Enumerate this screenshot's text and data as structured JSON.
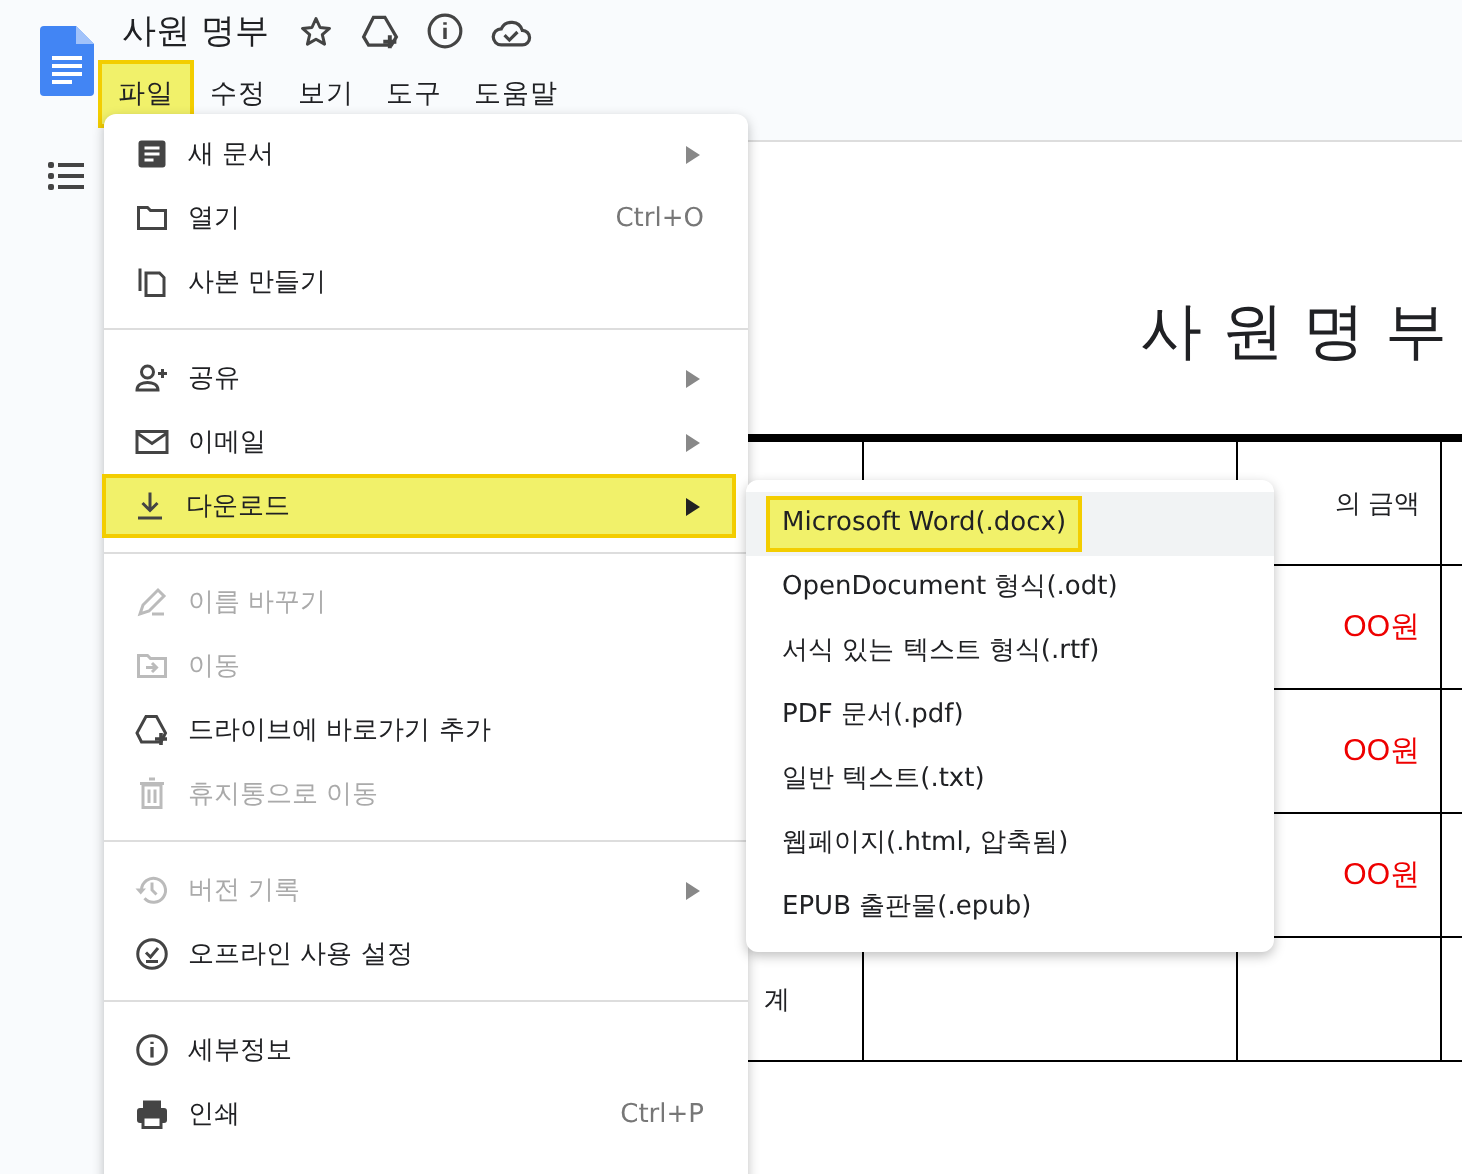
{
  "document": {
    "title": "사원 명부"
  },
  "menubar": [
    {
      "label": "파일",
      "selected": true
    },
    {
      "label": "수정",
      "selected": false
    },
    {
      "label": "보기",
      "selected": false
    },
    {
      "label": "도구",
      "selected": false
    },
    {
      "label": "도움말",
      "selected": false
    }
  ],
  "file_menu": {
    "groups": [
      [
        {
          "kind": "new",
          "label": "새 문서",
          "submenu": true,
          "disabled": false,
          "selected": false
        },
        {
          "kind": "open",
          "label": "열기",
          "shortcut": "Ctrl+O",
          "submenu": false,
          "disabled": false,
          "selected": false
        },
        {
          "kind": "copy",
          "label": "사본 만들기",
          "submenu": false,
          "disabled": false,
          "selected": false
        }
      ],
      [
        {
          "kind": "share",
          "label": "공유",
          "submenu": true,
          "disabled": false,
          "selected": false
        },
        {
          "kind": "email",
          "label": "이메일",
          "submenu": true,
          "disabled": false,
          "selected": false
        },
        {
          "kind": "download",
          "label": "다운로드",
          "submenu": true,
          "disabled": false,
          "selected": true
        }
      ],
      [
        {
          "kind": "rename",
          "label": "이름 바꾸기",
          "submenu": false,
          "disabled": true,
          "selected": false
        },
        {
          "kind": "move",
          "label": "이동",
          "submenu": false,
          "disabled": true,
          "selected": false
        },
        {
          "kind": "shortcut",
          "label": "드라이브에 바로가기 추가",
          "submenu": false,
          "disabled": false,
          "selected": false
        },
        {
          "kind": "trash",
          "label": "휴지통으로 이동",
          "submenu": false,
          "disabled": true,
          "selected": false
        }
      ],
      [
        {
          "kind": "history",
          "label": "버전 기록",
          "submenu": true,
          "disabled": true,
          "selected": false
        },
        {
          "kind": "offline",
          "label": "오프라인 사용 설정",
          "submenu": false,
          "disabled": false,
          "selected": false
        }
      ],
      [
        {
          "kind": "details",
          "label": "세부정보",
          "submenu": false,
          "disabled": false,
          "selected": false
        },
        {
          "kind": "print",
          "label": "인쇄",
          "shortcut": "Ctrl+P",
          "submenu": false,
          "disabled": false,
          "selected": false
        }
      ]
    ]
  },
  "download_menu": [
    {
      "label": "Microsoft Word(.docx)",
      "selected": true
    },
    {
      "label": "OpenDocument 형식(.odt)",
      "selected": false
    },
    {
      "label": "서식 있는 텍스트 형식(.rtf)",
      "selected": false
    },
    {
      "label": "PDF 문서(.pdf)",
      "selected": false
    },
    {
      "label": "일반 텍스트(.txt)",
      "selected": false
    },
    {
      "label": "웹페이지(.html, 압축됨)",
      "selected": false
    },
    {
      "label": "EPUB 출판물(.epub)",
      "selected": false
    }
  ],
  "page": {
    "heading": "사 원 명 부",
    "table": {
      "rows": [
        [
          "",
          "",
          "의 금액",
          ""
        ],
        [
          "",
          "",
          "OO원",
          ""
        ],
        [
          "",
          "",
          "OO원",
          ""
        ],
        [
          "",
          "",
          "OO원",
          ""
        ],
        [
          "계",
          "",
          "",
          ""
        ]
      ]
    }
  }
}
